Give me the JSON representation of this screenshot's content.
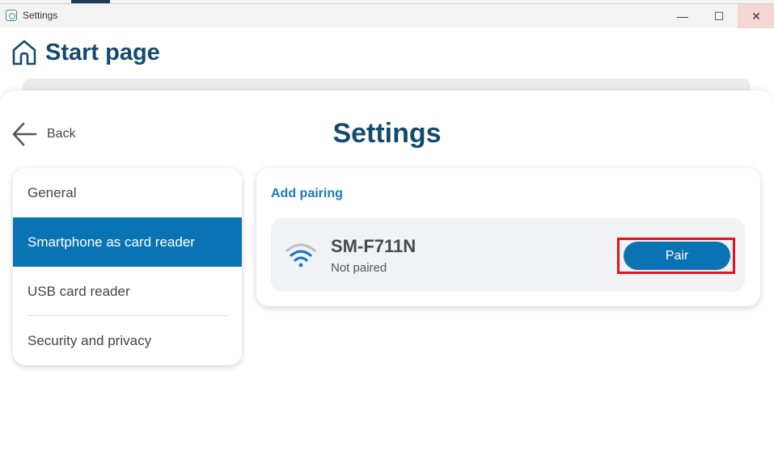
{
  "window": {
    "title": "Settings",
    "controls": {
      "minimize": "—",
      "maximize": "☐",
      "close": "✕"
    }
  },
  "start_page": {
    "title": "Start page"
  },
  "settings": {
    "back_label": "Back",
    "title": "Settings",
    "menu": [
      {
        "label": "General"
      },
      {
        "label": "Smartphone as card reader",
        "active": true
      },
      {
        "label": "USB card reader"
      },
      {
        "label": "Security and privacy"
      }
    ],
    "panel": {
      "heading": "Add pairing",
      "device": {
        "name": "SM-F711N",
        "status": "Not paired",
        "pair_label": "Pair"
      }
    }
  },
  "colors": {
    "primary": "#0a73b4",
    "title": "#134a6e",
    "link": "#1b7bbd",
    "highlight": "#e0141c"
  },
  "icons": [
    "home-icon",
    "back-arrow-icon",
    "wifi-icon",
    "app-icon"
  ]
}
